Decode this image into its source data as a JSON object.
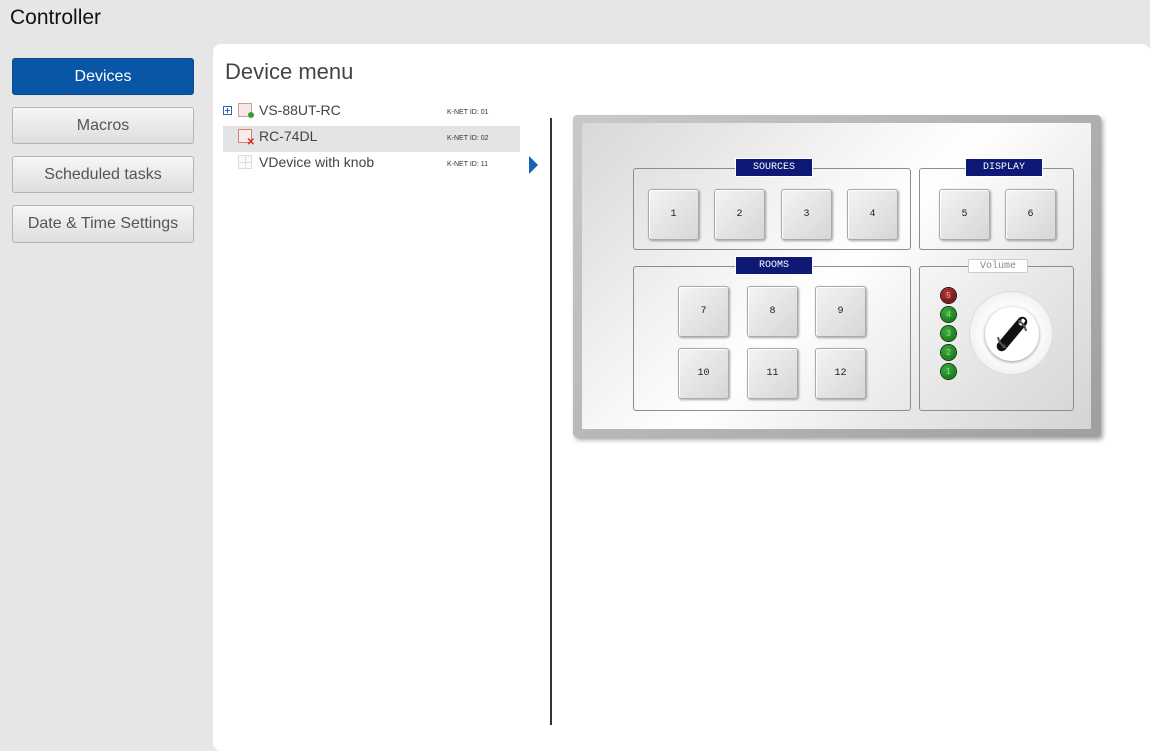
{
  "app": {
    "title": "Controller"
  },
  "sidebar": {
    "items": [
      {
        "label": "Devices",
        "active": true
      },
      {
        "label": "Macros",
        "active": false
      },
      {
        "label": "Scheduled tasks",
        "active": false
      },
      {
        "label": "Date & Time Settings",
        "active": false
      }
    ]
  },
  "main": {
    "title": "Device menu",
    "tree": [
      {
        "name": "VS-88UT-RC",
        "knet": "K-NET ID: 01",
        "icon": "device-online-icon",
        "expander": true,
        "selected": false
      },
      {
        "name": "RC-74DL",
        "knet": "K-NET ID: 02",
        "icon": "device-error-icon",
        "expander": false,
        "selected": true
      },
      {
        "name": "VDevice with knob",
        "knet": "K-NET ID: 11",
        "icon": "virtual-device-icon",
        "expander": false,
        "selected": false
      }
    ]
  },
  "device": {
    "groups": {
      "sources": "SOURCES",
      "display": "DISPLAY",
      "rooms": "ROOMS",
      "volume": "Volume"
    },
    "keys": [
      "1",
      "2",
      "3",
      "4",
      "5",
      "6",
      "7",
      "8",
      "9",
      "10",
      "11",
      "12"
    ],
    "leds": [
      "5",
      "4",
      "3",
      "2",
      "1"
    ],
    "colors": {
      "label_bg": "#0e1875",
      "active_nav": "#0a56a6",
      "led_green": "#1a8a1a",
      "led_red": "#8a1a1a"
    }
  }
}
